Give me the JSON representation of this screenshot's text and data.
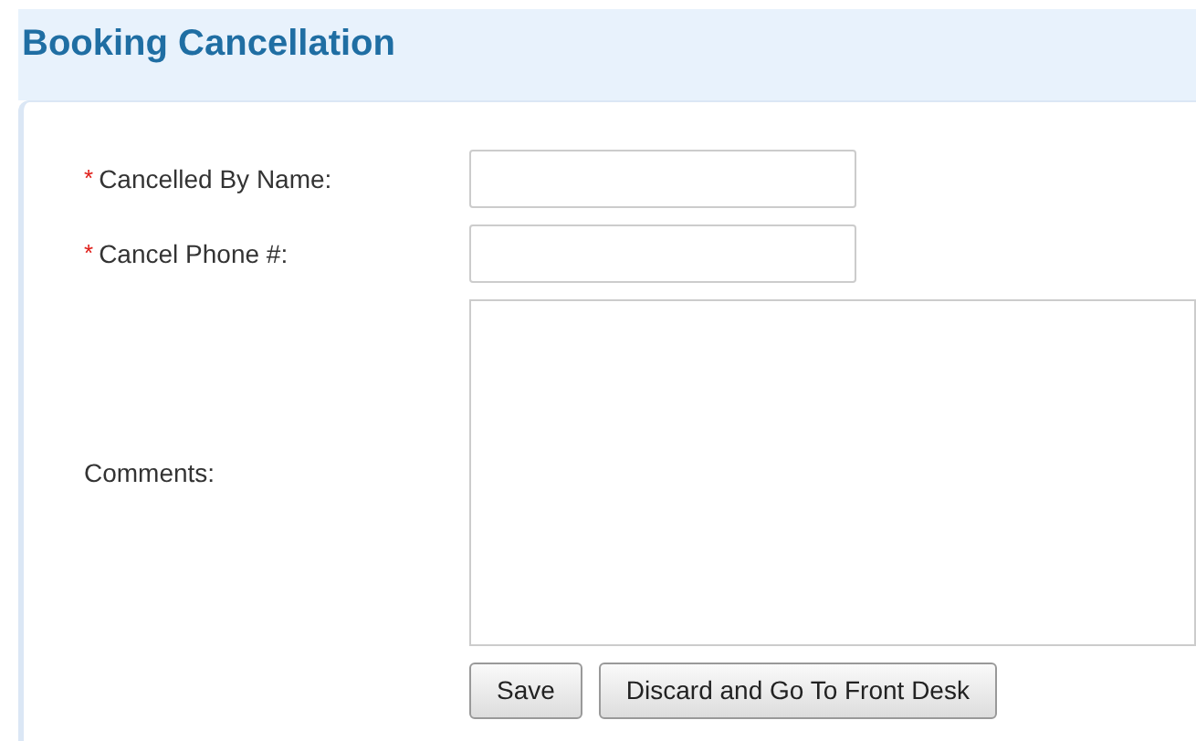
{
  "page": {
    "title": "Booking Cancellation"
  },
  "fields": [
    {
      "label": "Cancelled By Name:",
      "required": true,
      "kind": "text"
    },
    {
      "label": "Cancel Phone #:",
      "required": true,
      "kind": "text"
    },
    {
      "label": "Comments:",
      "required": false,
      "kind": "textarea"
    }
  ],
  "required_marker": "*",
  "buttons": [
    "Save",
    "Discard and Go To Front Desk"
  ]
}
